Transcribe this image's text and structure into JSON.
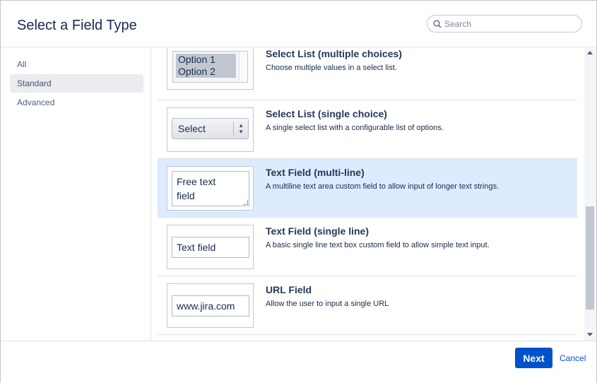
{
  "dialog": {
    "title": "Select a Field Type",
    "search": {
      "placeholder": "Search",
      "value": ""
    }
  },
  "sidebar": {
    "items": [
      {
        "label": "All",
        "active": false
      },
      {
        "label": "Standard",
        "active": true
      },
      {
        "label": "Advanced",
        "active": false
      }
    ]
  },
  "fields": [
    {
      "title": "Select List (multiple choices)",
      "description": "Choose multiple values in a select list.",
      "preview": {
        "options": [
          "Option 1",
          "Option 2"
        ]
      }
    },
    {
      "title": "Select List (single choice)",
      "description": "A single select list with a configurable list of options.",
      "preview": {
        "value": "Select"
      }
    },
    {
      "title": "Text Field (multi-line)",
      "description": "A multiline text area custom field to allow input of longer text strings.",
      "preview": {
        "line1": "Free text",
        "line2": "field"
      },
      "selected": true
    },
    {
      "title": "Text Field (single line)",
      "description": "A basic single line text box custom field to allow simple text input.",
      "preview": {
        "value": "Text field"
      }
    },
    {
      "title": "URL Field",
      "description": "Allow the user to input a single URL",
      "preview": {
        "value": "www.jira.com"
      }
    }
  ],
  "footer": {
    "next_label": "Next",
    "cancel_label": "Cancel"
  },
  "colors": {
    "accent": "#0052cc",
    "selected_row": "#deebff",
    "active_nav": "#ebecf0"
  },
  "icons": [
    "search-icon",
    "scroll-up-icon",
    "scroll-down-icon",
    "select-arrows-icon",
    "resize-grip-icon"
  ]
}
